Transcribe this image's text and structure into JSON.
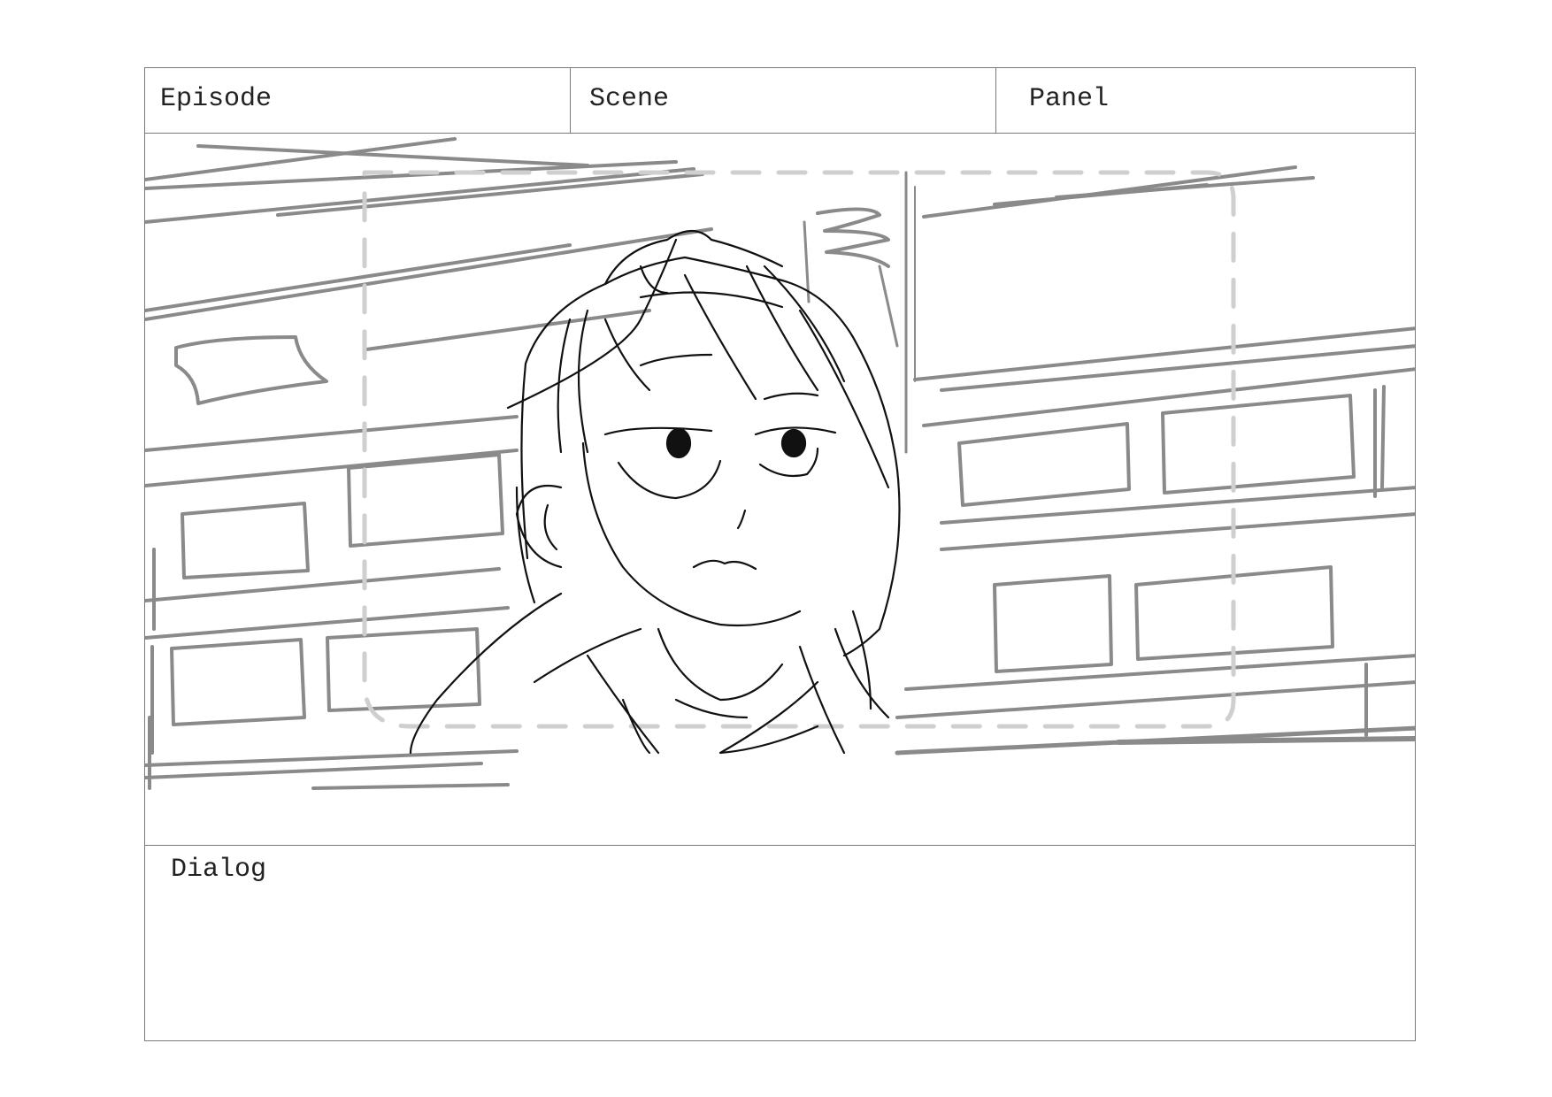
{
  "header": {
    "episode_label": "Episode",
    "scene_label": "Scene",
    "panel_label": "Panel"
  },
  "panel": {
    "sketch": "rough-sketch-drawing"
  },
  "dialog": {
    "label": "Dialog"
  }
}
